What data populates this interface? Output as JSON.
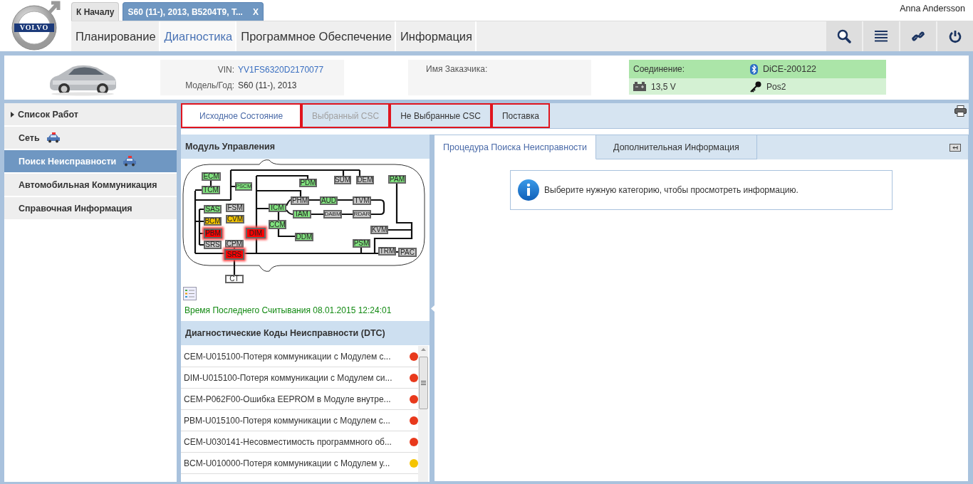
{
  "header": {
    "logo": "VOLVO",
    "user": "Anna Andersson",
    "tabs": [
      {
        "label": "К Началу",
        "selected": false
      },
      {
        "label": "S60 (11-), 2013, B5204T9, T...",
        "selected": true,
        "close": "X"
      }
    ],
    "menu": [
      {
        "label": "Планирование",
        "selected": false
      },
      {
        "label": "Диагностика",
        "selected": true
      },
      {
        "label": "Программное Обеспечение",
        "selected": false
      },
      {
        "label": "Информация",
        "selected": false
      }
    ]
  },
  "vehicle": {
    "vin_label": "VIN:",
    "vin": "YV1FS6320D2170077",
    "model_label": "Модель/Год:",
    "model": "S60 (11-), 2013",
    "customer_label": "Имя Заказчика:"
  },
  "connection": {
    "label": "Соединение:",
    "device": "DiCE-200122",
    "voltage": "13,5 V",
    "key_position": "Pos2"
  },
  "sidebar": {
    "items": [
      {
        "label": "Список Работ",
        "kind": "group",
        "selected": false,
        "car_badge": false
      },
      {
        "label": "Сеть",
        "kind": "item",
        "selected": false,
        "car_badge": true
      },
      {
        "label": "Поиск Неисправности",
        "kind": "item",
        "selected": true,
        "car_badge": true
      },
      {
        "label": "Автомобильная Коммуникация",
        "kind": "item",
        "selected": false,
        "car_badge": false
      },
      {
        "label": "Справочная Информация",
        "kind": "item",
        "selected": false,
        "car_badge": false
      }
    ]
  },
  "work_tabs": [
    {
      "label": "Исходное Состояние",
      "selected": true,
      "disabled": false,
      "highlighted": true
    },
    {
      "label": "Выбранный CSC",
      "selected": false,
      "disabled": true,
      "highlighted": true
    },
    {
      "label": "Не Выбранные CSC",
      "selected": false,
      "disabled": false,
      "highlighted": true
    },
    {
      "label": "Поставка",
      "selected": false,
      "disabled": false,
      "highlighted": true
    }
  ],
  "module_panel": {
    "title": "Модуль Управления",
    "last_read": "Время Последнего Считывания 08.01.2015 12:24:01",
    "nodes": [
      {
        "label": "ECM",
        "color": "#80e27e"
      },
      {
        "label": "TCM",
        "color": "#80e27e"
      },
      {
        "label": "PSCM",
        "color": "#80e27e"
      },
      {
        "label": "PDM",
        "color": "#80e27e"
      },
      {
        "label": "SUM",
        "color": "#c8c8c8"
      },
      {
        "label": "DEM",
        "color": "#c8c8c8"
      },
      {
        "label": "PAM",
        "color": "#80e27e"
      },
      {
        "label": "PHM",
        "color": "#c8c8c8"
      },
      {
        "label": "AUD",
        "color": "#80e27e"
      },
      {
        "label": "TVM",
        "color": "#c8c8c8"
      },
      {
        "label": "ICM",
        "color": "#80e27e"
      },
      {
        "label": "IAM",
        "color": "#80e27e"
      },
      {
        "label": "DABM",
        "color": "#c8c8c8"
      },
      {
        "label": "RDAR",
        "color": "#c8c8c8"
      },
      {
        "label": "SAS",
        "color": "#80e27e"
      },
      {
        "label": "FSM",
        "color": "#c8c8c8"
      },
      {
        "label": "BCM",
        "color": "#f2c300"
      },
      {
        "label": "CVM",
        "color": "#f2c300"
      },
      {
        "label": "PBM",
        "color": "#ff0000"
      },
      {
        "label": "DIM",
        "color": "#ff0000"
      },
      {
        "label": "CCM",
        "color": "#80e27e"
      },
      {
        "label": "KVM",
        "color": "#c8c8c8"
      },
      {
        "label": "DDM",
        "color": "#80e27e"
      },
      {
        "label": "SRS",
        "color": "#c8c8c8"
      },
      {
        "label": "CPM",
        "color": "#c8c8c8"
      },
      {
        "label": "PSM",
        "color": "#80e27e"
      },
      {
        "label": "SRS",
        "color": "#ff0000"
      },
      {
        "label": "TRM",
        "color": "#c8c8c8"
      },
      {
        "label": "PAC",
        "color": "#c8c8c8"
      },
      {
        "label": "CT",
        "color": "#ffffff"
      }
    ]
  },
  "dtc_panel": {
    "title": "Диагностические Коды Неисправности (DTC)",
    "rows": [
      {
        "text": "CEM-U015100-Потеря коммуникации с Модулем с...",
        "color": "#e8391c"
      },
      {
        "text": "DIM-U015100-Потеря коммуникации с Модулем си...",
        "color": "#e8391c"
      },
      {
        "text": "CEM-P062F00-Ошибка EEPROM в Модуле внутре...",
        "color": "#e8391c"
      },
      {
        "text": "PBM-U015100-Потеря коммуникации с Модулем с...",
        "color": "#e8391c"
      },
      {
        "text": "CEM-U030141-Несовместимость программного об...",
        "color": "#e8391c"
      },
      {
        "text": "BCM-U010000-Потеря коммуникации с Модулем у...",
        "color": "#f5c400"
      }
    ]
  },
  "info_panel": {
    "tabs": [
      {
        "label": "Процедура Поиска Неисправности",
        "selected": true
      },
      {
        "label": "Дополнительная Информация",
        "selected": false
      }
    ],
    "message": "Выберите нужную категорию, чтобы просмотреть информацию."
  }
}
